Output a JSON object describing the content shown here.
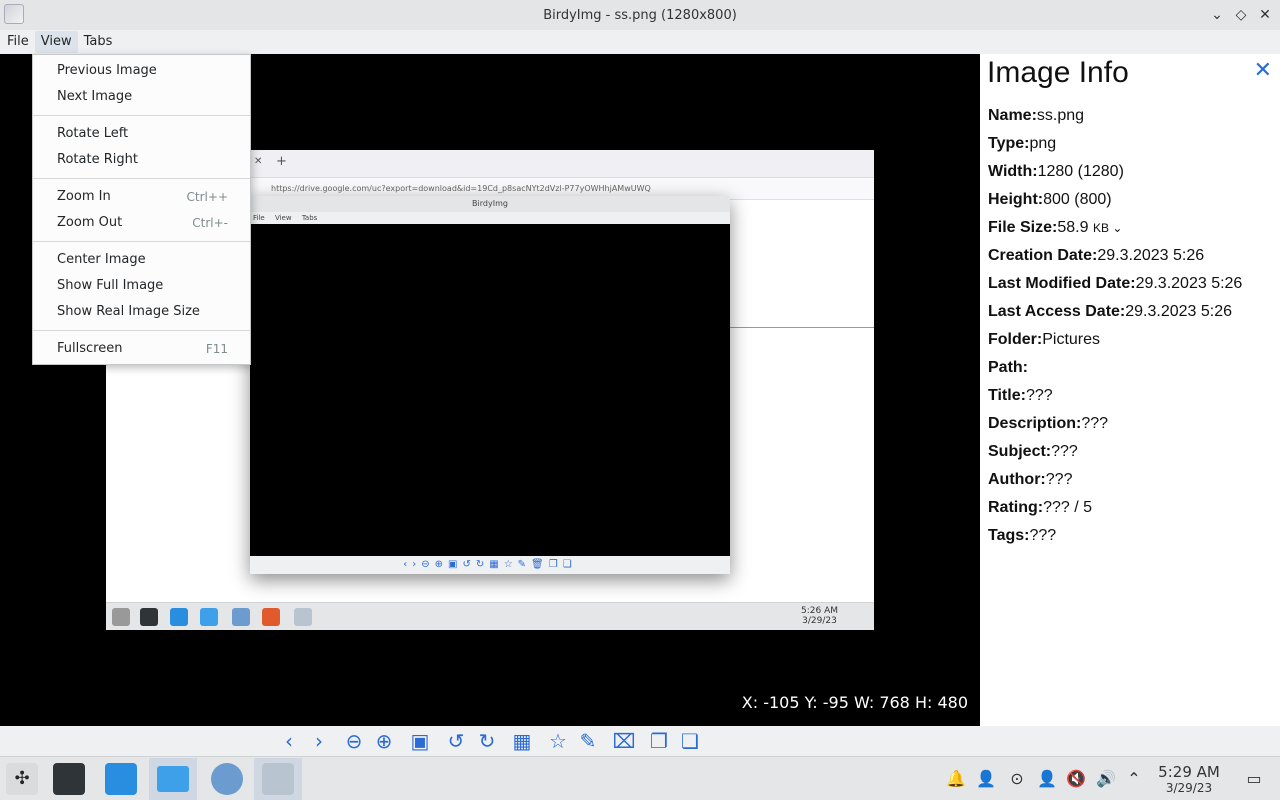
{
  "window": {
    "title": "BirdyImg - ss.png (1280x800)",
    "buttons": {
      "minimize": "⌄",
      "maximize": "◇",
      "close": "✕"
    }
  },
  "menubar": {
    "file": "File",
    "view": "View",
    "tabs": "Tabs"
  },
  "view_menu": {
    "previous_image": "Previous Image",
    "next_image": "Next Image",
    "rotate_left": "Rotate Left",
    "rotate_right": "Rotate Right",
    "zoom_in": "Zoom In",
    "zoom_in_shortcut": "Ctrl++",
    "zoom_out": "Zoom Out",
    "zoom_out_shortcut": "Ctrl+-",
    "center_image": "Center Image",
    "show_full_image": "Show Full Image",
    "show_real_size": "Show Real Image Size",
    "fullscreen": "Fullscreen",
    "fullscreen_shortcut": "F11"
  },
  "viewer": {
    "coords": "X: -105 Y: -95 W: 768 H: 480",
    "inner_screenshot": {
      "url": "https://drive.google.com/uc?export=download&id=19Cd_p8sacNYt2dVzl-P77yOWHhjAMwUWQ",
      "nested_title": "BirdyImg",
      "nested_menu": {
        "file": "File",
        "view": "View",
        "tabs": "Tabs"
      },
      "clock_time": "5:26 AM",
      "clock_date": "3/29/23"
    }
  },
  "info_panel": {
    "heading": "Image Info",
    "name_label": "Name:",
    "name_value": "ss.png",
    "type_label": "Type:",
    "type_value": "png",
    "width_label": "Width:",
    "width_value": "1280 (1280)",
    "height_label": "Height:",
    "height_value": "800 (800)",
    "filesize_label": "File Size:",
    "filesize_value": "58.9",
    "filesize_unit": "KB",
    "created_label": "Creation Date:",
    "created_value": "29.3.2023 5:26",
    "modified_label": "Last Modified Date:",
    "modified_value": "29.3.2023 5:26",
    "accessed_label": "Last Access Date:",
    "accessed_value": "29.3.2023 5:26",
    "folder_label": "Folder:",
    "folder_value": "Pictures",
    "path_label": "Path:",
    "path_value": "",
    "title_label": "Title:",
    "title_value": "???",
    "desc_label": "Description:",
    "desc_value": "???",
    "subject_label": "Subject:",
    "subject_value": "???",
    "author_label": "Author:",
    "author_value": "???",
    "rating_label": "Rating:",
    "rating_value": "??? / 5",
    "tags_label": "Tags:",
    "tags_value": "???"
  },
  "toolbar_icons": [
    "chevron-left-icon",
    "chevron-right-icon",
    "zoom-out-icon",
    "zoom-in-icon",
    "fit-icon",
    "rotate-left-icon",
    "rotate-right-icon",
    "grid-icon",
    "star-icon",
    "edit-icon",
    "delete-icon",
    "copy-icon",
    "gallery-icon"
  ],
  "taskbar": {
    "time": "5:29 AM",
    "date": "3/29/23"
  },
  "colors": {
    "accent": "#2a6bd8",
    "viewer_bg": "#000000",
    "panel_bg": "#ffffff"
  }
}
